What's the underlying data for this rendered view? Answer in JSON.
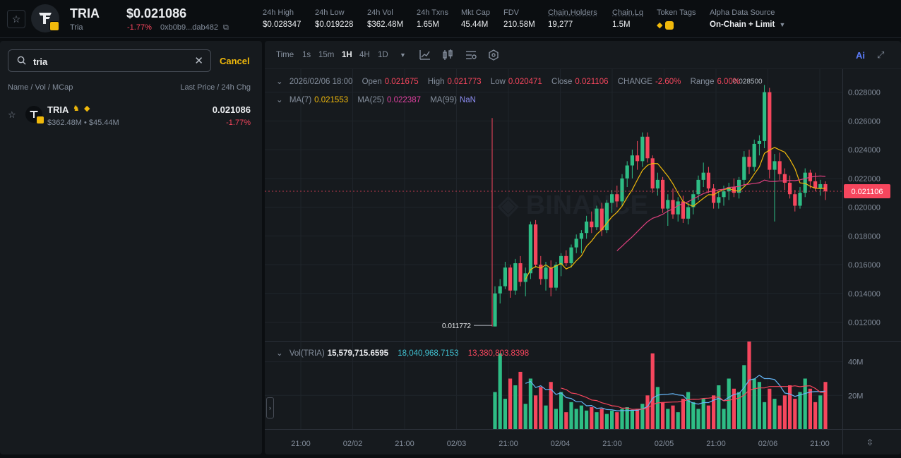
{
  "header": {
    "token_name": "TRIA",
    "token_sub": "Tria",
    "price": "$0.021086",
    "change": "-1.77%",
    "contract": "0xb0b9...dab482",
    "stats": [
      {
        "label": "24h High",
        "value": "$0.028347"
      },
      {
        "label": "24h Low",
        "value": "$0.019228"
      },
      {
        "label": "24h Vol",
        "value": "$362.48M"
      },
      {
        "label": "24h Txns",
        "value": "1.65M"
      },
      {
        "label": "Mkt Cap",
        "value": "45.44M"
      },
      {
        "label": "FDV",
        "value": "210.58M"
      },
      {
        "label": "Chain.Holders",
        "value": "19,277"
      },
      {
        "label": "Chain.Lq",
        "value": "1.5M"
      }
    ],
    "tags_label": "Token Tags",
    "source_label": "Alpha Data Source",
    "source_value": "On-Chain + Limit",
    "icons": [
      "star-outline-icon",
      "token-logo-icon",
      "copy-icon",
      "diamond-icon",
      "binance-badge-icon",
      "caret-down-icon"
    ]
  },
  "search": {
    "value": "tria",
    "cancel_label": "Cancel",
    "head_left": "Name / Vol / MCap",
    "head_right": "Last Price / 24h Chg"
  },
  "token_row": {
    "name": "TRIA",
    "sub": "$362.48M • $45.44M",
    "price": "0.021086",
    "change": "-1.77%"
  },
  "toolbar": {
    "items": [
      "Time",
      "1s",
      "15m",
      "1H",
      "4H",
      "1D"
    ],
    "active": "1H",
    "ai_label": "Ai"
  },
  "legend": {
    "date": "2026/02/06 18:00",
    "open_label": "Open",
    "open": "0.021675",
    "high_label": "High",
    "high": "0.021773",
    "low_label": "Low",
    "low": "0.020471",
    "close_label": "Close",
    "close": "0.021106",
    "change_label": "CHANGE",
    "change": "-2.60%",
    "range_label": "Range",
    "range": "6.00%",
    "ma7_label": "MA(7)",
    "ma7": "0.021553",
    "ma25_label": "MA(25)",
    "ma25": "0.022387",
    "ma99_label": "MA(99)",
    "ma99": "NaN",
    "vol_label": "Vol(TRIA)",
    "vol": "15,579,715.6595",
    "vol_ma1": "18,040,968.7153",
    "vol_ma2": "13,380,803.8398"
  },
  "colors": {
    "up": "#2ebd85",
    "down": "#f6465d",
    "accent": "#f0b90b",
    "bg": "#161a1e",
    "ma7": "#f0b90b",
    "ma25": "#e0407f",
    "vol_ma": "#64b5f6"
  },
  "chart_data": {
    "type": "candlestick",
    "interval": "1H",
    "price_axis": {
      "ticks": [
        "0.028000",
        "0.026000",
        "0.024000",
        "0.022000",
        "0.020000",
        "0.018000",
        "0.016000",
        "0.014000",
        "0.012000"
      ],
      "range": [
        0.0107,
        0.0296
      ]
    },
    "volume_axis": {
      "ticks": [
        "40M",
        "20M"
      ],
      "max": 52000000
    },
    "time_ticks": [
      "21:00",
      "02/02",
      "21:00",
      "02/03",
      "21:00",
      "02/04",
      "21:00",
      "02/05",
      "21:00",
      "02/06",
      "21:00"
    ],
    "current_price_label": "0.021106",
    "high_marker": "0.028500",
    "low_marker": "0.011772",
    "candles": [
      [
        0.0117,
        0.0145,
        0.0117,
        0.014
      ],
      [
        0.014,
        0.015,
        0.0133,
        0.0145
      ],
      [
        0.0145,
        0.0162,
        0.0143,
        0.0158
      ],
      [
        0.0158,
        0.016,
        0.0137,
        0.0142
      ],
      [
        0.0142,
        0.0164,
        0.0139,
        0.0161
      ],
      [
        0.0161,
        0.0166,
        0.0145,
        0.0148
      ],
      [
        0.0148,
        0.0158,
        0.0138,
        0.0154
      ],
      [
        0.0154,
        0.019,
        0.015,
        0.0188
      ],
      [
        0.0188,
        0.0191,
        0.0158,
        0.016
      ],
      [
        0.016,
        0.0166,
        0.0146,
        0.015
      ],
      [
        0.015,
        0.0162,
        0.0142,
        0.0158
      ],
      [
        0.0158,
        0.0163,
        0.0138,
        0.0144
      ],
      [
        0.0144,
        0.0162,
        0.0142,
        0.016
      ],
      [
        0.016,
        0.0168,
        0.0152,
        0.0166
      ],
      [
        0.0166,
        0.017,
        0.0159,
        0.0161
      ],
      [
        0.0161,
        0.0174,
        0.0158,
        0.0172
      ],
      [
        0.0172,
        0.0181,
        0.0168,
        0.0178
      ],
      [
        0.0178,
        0.0184,
        0.0168,
        0.0182
      ],
      [
        0.0182,
        0.0194,
        0.0178,
        0.019
      ],
      [
        0.019,
        0.0197,
        0.0182,
        0.0186
      ],
      [
        0.0186,
        0.0201,
        0.0184,
        0.0199
      ],
      [
        0.0199,
        0.0203,
        0.018,
        0.0184
      ],
      [
        0.0184,
        0.0205,
        0.0182,
        0.0203
      ],
      [
        0.0203,
        0.0212,
        0.0196,
        0.0209
      ],
      [
        0.0209,
        0.0215,
        0.02,
        0.0204
      ],
      [
        0.0204,
        0.0223,
        0.0201,
        0.022
      ],
      [
        0.022,
        0.0232,
        0.0214,
        0.0229
      ],
      [
        0.0229,
        0.024,
        0.022,
        0.0236
      ],
      [
        0.0236,
        0.0246,
        0.0226,
        0.0232
      ],
      [
        0.0232,
        0.0252,
        0.0228,
        0.0249
      ],
      [
        0.0249,
        0.0252,
        0.0231,
        0.0234
      ],
      [
        0.0234,
        0.0236,
        0.021,
        0.0213
      ],
      [
        0.0213,
        0.0224,
        0.0208,
        0.0219
      ],
      [
        0.0219,
        0.0221,
        0.0196,
        0.0199
      ],
      [
        0.0199,
        0.0209,
        0.0187,
        0.0205
      ],
      [
        0.0205,
        0.0213,
        0.0192,
        0.0195
      ],
      [
        0.0195,
        0.0207,
        0.019,
        0.0204
      ],
      [
        0.0204,
        0.0208,
        0.0189,
        0.0192
      ],
      [
        0.0192,
        0.0203,
        0.0188,
        0.02
      ],
      [
        0.02,
        0.0212,
        0.0195,
        0.0209
      ],
      [
        0.0209,
        0.0222,
        0.0205,
        0.0219
      ],
      [
        0.0219,
        0.0231,
        0.0214,
        0.0224
      ],
      [
        0.0224,
        0.0228,
        0.021,
        0.0213
      ],
      [
        0.0213,
        0.0216,
        0.0199,
        0.0203
      ],
      [
        0.0203,
        0.0211,
        0.0199,
        0.0207
      ],
      [
        0.0207,
        0.0215,
        0.0201,
        0.0211
      ],
      [
        0.0211,
        0.0217,
        0.0205,
        0.0214
      ],
      [
        0.0214,
        0.022,
        0.0207,
        0.021
      ],
      [
        0.021,
        0.0221,
        0.0206,
        0.0219
      ],
      [
        0.0219,
        0.0239,
        0.0214,
        0.0235
      ],
      [
        0.0235,
        0.024,
        0.0223,
        0.0228
      ],
      [
        0.0228,
        0.0247,
        0.0225,
        0.0244
      ],
      [
        0.0244,
        0.025,
        0.0236,
        0.0246
      ],
      [
        0.0246,
        0.0285,
        0.0241,
        0.028
      ],
      [
        0.028,
        0.0283,
        0.022,
        0.0226
      ],
      [
        0.0226,
        0.0237,
        0.019,
        0.0232
      ],
      [
        0.0232,
        0.0238,
        0.0219,
        0.0223
      ],
      [
        0.0223,
        0.0227,
        0.0212,
        0.0217
      ],
      [
        0.0217,
        0.0222,
        0.0206,
        0.0209
      ],
      [
        0.0209,
        0.0212,
        0.0197,
        0.0201
      ],
      [
        0.0201,
        0.0214,
        0.0199,
        0.021
      ],
      [
        0.021,
        0.0227,
        0.0207,
        0.0224
      ],
      [
        0.0224,
        0.0226,
        0.0213,
        0.0218
      ],
      [
        0.0218,
        0.0224,
        0.0211,
        0.0213
      ],
      [
        0.0213,
        0.0219,
        0.0208,
        0.0216
      ],
      [
        0.0216,
        0.0218,
        0.0205,
        0.0211
      ]
    ],
    "volumes": [
      22,
      45,
      18,
      30,
      26,
      34,
      15,
      30,
      20,
      25,
      14,
      28,
      12,
      22,
      10,
      16,
      12,
      14,
      11,
      13,
      10,
      12,
      9,
      11,
      10,
      12,
      13,
      11,
      12,
      15,
      20,
      45,
      25,
      16,
      12,
      14,
      10,
      18,
      22,
      16,
      12,
      18,
      14,
      20,
      26,
      12,
      30,
      24,
      22,
      38,
      52,
      30,
      28,
      16,
      24,
      18,
      14,
      20,
      26,
      18,
      22,
      30,
      24,
      16,
      20,
      28
    ],
    "ma7_visible": true,
    "ma25_visible": true
  }
}
